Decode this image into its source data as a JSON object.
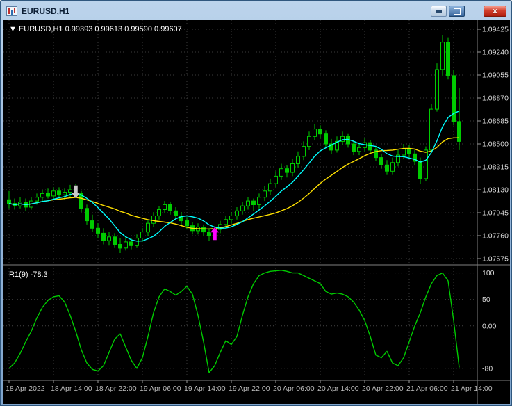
{
  "window": {
    "title": "EURUSD,H1",
    "close_glyph": "×"
  },
  "chart": {
    "info": {
      "dropdown_icon": "▼",
      "symbol": "EURUSD,H1",
      "ohlc_values": "0.99393 0.99613 0.99590 0.99607"
    },
    "price_max": 1.09425,
    "price_min": 1.07575,
    "price_axis_labels": [
      "1.09425",
      "1.09240",
      "1.09055",
      "1.08870",
      "1.08685",
      "1.08500",
      "1.08315",
      "1.08130",
      "1.07945",
      "1.07760",
      "1.07575"
    ],
    "time_axis_labels": [
      "18 Apr 2022",
      "18 Apr 14:00",
      "18 Apr 22:00",
      "19 Apr 06:00",
      "19 Apr 14:00",
      "19 Apr 22:00",
      "20 Apr 06:00",
      "20 Apr 14:00",
      "20 Apr 22:00",
      "21 Apr 06:00",
      "21 Apr 14:00"
    ],
    "colors": {
      "candle": "#00CC00",
      "grid": "#3C3C3C",
      "axis_text": "#DCDCDC",
      "time_text": "#BEBEBE",
      "separator": "#7F7F7F",
      "info_text": "#FFFFFF"
    },
    "ma": {
      "fast_period": 8,
      "fast_color": "#00FFFF",
      "slow_period": 20,
      "slow_color": "#FFE100"
    },
    "arrows": [
      {
        "direction": "down",
        "index": 12,
        "price": 1.0806,
        "color": "#C8C8C8"
      },
      {
        "direction": "up",
        "index": 37,
        "price": 1.0783,
        "color": "#FF00FF"
      }
    ],
    "candles": [
      [
        1.0805,
        1.0812,
        1.0798,
        1.0802
      ],
      [
        1.0802,
        1.0806,
        1.0797,
        1.08
      ],
      [
        1.08,
        1.0807,
        1.0798,
        1.0803
      ],
      [
        1.0803,
        1.0806,
        1.0796,
        1.0799
      ],
      [
        1.0799,
        1.0807,
        1.0797,
        1.0804
      ],
      [
        1.0804,
        1.081,
        1.0801,
        1.0807
      ],
      [
        1.0807,
        1.0813,
        1.0804,
        1.081
      ],
      [
        1.081,
        1.0814,
        1.0806,
        1.0808
      ],
      [
        1.0808,
        1.0815,
        1.0805,
        1.0812
      ],
      [
        1.0812,
        1.0815,
        1.0806,
        1.0809
      ],
      [
        1.0809,
        1.0814,
        1.0805,
        1.0811
      ],
      [
        1.0811,
        1.0817,
        1.0807,
        1.0813
      ],
      [
        1.0813,
        1.0818,
        1.0808,
        1.081
      ],
      [
        1.081,
        1.0812,
        1.0795,
        1.0798
      ],
      [
        1.0798,
        1.0801,
        1.0785,
        1.0788
      ],
      [
        1.0788,
        1.0793,
        1.0779,
        1.0782
      ],
      [
        1.0782,
        1.0786,
        1.0774,
        1.0778
      ],
      [
        1.0778,
        1.0782,
        1.0769,
        1.0772
      ],
      [
        1.0772,
        1.0779,
        1.0768,
        1.0775
      ],
      [
        1.0775,
        1.0778,
        1.0766,
        1.0769
      ],
      [
        1.0769,
        1.0774,
        1.0762,
        1.0766
      ],
      [
        1.0766,
        1.0775,
        1.0764,
        1.0771
      ],
      [
        1.0771,
        1.0774,
        1.0765,
        1.0768
      ],
      [
        1.0768,
        1.0777,
        1.0766,
        1.0774
      ],
      [
        1.0774,
        1.0782,
        1.0771,
        1.0779
      ],
      [
        1.0779,
        1.0789,
        1.0776,
        1.0786
      ],
      [
        1.0786,
        1.0795,
        1.0783,
        1.0792
      ],
      [
        1.0792,
        1.08,
        1.0789,
        1.0797
      ],
      [
        1.0797,
        1.0804,
        1.0794,
        1.0801
      ],
      [
        1.0801,
        1.0803,
        1.0793,
        1.0796
      ],
      [
        1.0796,
        1.0799,
        1.0789,
        1.0792
      ],
      [
        1.0792,
        1.0795,
        1.0785,
        1.0788
      ],
      [
        1.0788,
        1.0791,
        1.0781,
        1.0784
      ],
      [
        1.0784,
        1.0787,
        1.0777,
        1.078
      ],
      [
        1.078,
        1.0786,
        1.0777,
        1.0783
      ],
      [
        1.0783,
        1.0785,
        1.0776,
        1.0779
      ],
      [
        1.0779,
        1.0782,
        1.0772,
        1.0776
      ],
      [
        1.0776,
        1.0783,
        1.0773,
        1.0781
      ],
      [
        1.0781,
        1.0788,
        1.0778,
        1.0785
      ],
      [
        1.0785,
        1.0792,
        1.0782,
        1.0789
      ],
      [
        1.0789,
        1.0795,
        1.0786,
        1.0792
      ],
      [
        1.0792,
        1.0799,
        1.0789,
        1.0796
      ],
      [
        1.0796,
        1.0803,
        1.0793,
        1.08
      ],
      [
        1.08,
        1.0807,
        1.0797,
        1.0804
      ],
      [
        1.0804,
        1.0806,
        1.0796,
        1.0801
      ],
      [
        1.0801,
        1.081,
        1.0798,
        1.0807
      ],
      [
        1.0807,
        1.0816,
        1.0804,
        1.0812
      ],
      [
        1.0812,
        1.0822,
        1.0809,
        1.0818
      ],
      [
        1.0818,
        1.0828,
        1.0815,
        1.0824
      ],
      [
        1.0824,
        1.0834,
        1.0821,
        1.083
      ],
      [
        1.083,
        1.0833,
        1.0823,
        1.0827
      ],
      [
        1.0827,
        1.0838,
        1.0824,
        1.0834
      ],
      [
        1.0834,
        1.0844,
        1.0831,
        1.084
      ],
      [
        1.084,
        1.0852,
        1.0837,
        1.0848
      ],
      [
        1.0848,
        1.086,
        1.0845,
        1.0856
      ],
      [
        1.0856,
        1.0866,
        1.0853,
        1.0862
      ],
      [
        1.0862,
        1.0865,
        1.0854,
        1.0858
      ],
      [
        1.0858,
        1.0861,
        1.0847,
        1.085
      ],
      [
        1.085,
        1.0854,
        1.0842,
        1.0845
      ],
      [
        1.0845,
        1.0856,
        1.0843,
        1.0852
      ],
      [
        1.0852,
        1.086,
        1.0849,
        1.0856
      ],
      [
        1.0856,
        1.0858,
        1.0847,
        1.085
      ],
      [
        1.085,
        1.0853,
        1.0841,
        1.0844
      ],
      [
        1.0844,
        1.0851,
        1.0841,
        1.0847
      ],
      [
        1.0847,
        1.0855,
        1.0844,
        1.0851
      ],
      [
        1.0851,
        1.0853,
        1.0842,
        1.0845
      ],
      [
        1.0845,
        1.0848,
        1.0836,
        1.0839
      ],
      [
        1.0839,
        1.0842,
        1.083,
        1.0833
      ],
      [
        1.0833,
        1.0837,
        1.0825,
        1.0828
      ],
      [
        1.0828,
        1.0839,
        1.0825,
        1.0835
      ],
      [
        1.0835,
        1.0845,
        1.0832,
        1.0841
      ],
      [
        1.0841,
        1.085,
        1.0838,
        1.0846
      ],
      [
        1.0846,
        1.0849,
        1.0839,
        1.0842
      ],
      [
        1.0842,
        1.0845,
        1.0833,
        1.0836
      ],
      [
        1.0836,
        1.0839,
        1.0818,
        1.0822
      ],
      [
        1.0822,
        1.0848,
        1.082,
        1.0845
      ],
      [
        1.0845,
        1.0882,
        1.0843,
        1.0878
      ],
      [
        1.0878,
        1.0915,
        1.0876,
        1.091
      ],
      [
        1.091,
        1.0938,
        1.0905,
        1.0932
      ],
      [
        1.0932,
        1.0936,
        1.0902,
        1.0905
      ],
      [
        1.0905,
        1.091,
        1.0865,
        1.0868
      ],
      [
        1.0868,
        1.0895,
        1.0845,
        1.0852
      ]
    ]
  },
  "indicator": {
    "label": "R1(9) -78.3",
    "line_color": "#00CC00",
    "scale_max": 110,
    "scale_min": -100,
    "levels": [
      {
        "value": 100,
        "label": "100"
      },
      {
        "value": 50,
        "label": "50"
      },
      {
        "value": 0,
        "label": "0.00"
      },
      {
        "value": -80,
        "label": "-80"
      }
    ],
    "values": [
      -80,
      -70,
      -52,
      -30,
      -10,
      15,
      35,
      48,
      55,
      57,
      45,
      20,
      -10,
      -45,
      -70,
      -82,
      -85,
      -75,
      -50,
      -25,
      -15,
      -40,
      -65,
      -80,
      -60,
      -20,
      25,
      55,
      70,
      65,
      58,
      65,
      75,
      60,
      20,
      -30,
      -88,
      -75,
      -50,
      -28,
      -35,
      -20,
      20,
      55,
      80,
      95,
      100,
      103,
      104,
      105,
      103,
      100,
      100,
      95,
      90,
      85,
      80,
      65,
      60,
      62,
      60,
      55,
      45,
      30,
      10,
      -20,
      -55,
      -60,
      -48,
      -70,
      -75,
      -60,
      -30,
      0,
      25,
      55,
      80,
      95,
      100,
      85,
      10,
      -78.3
    ]
  }
}
